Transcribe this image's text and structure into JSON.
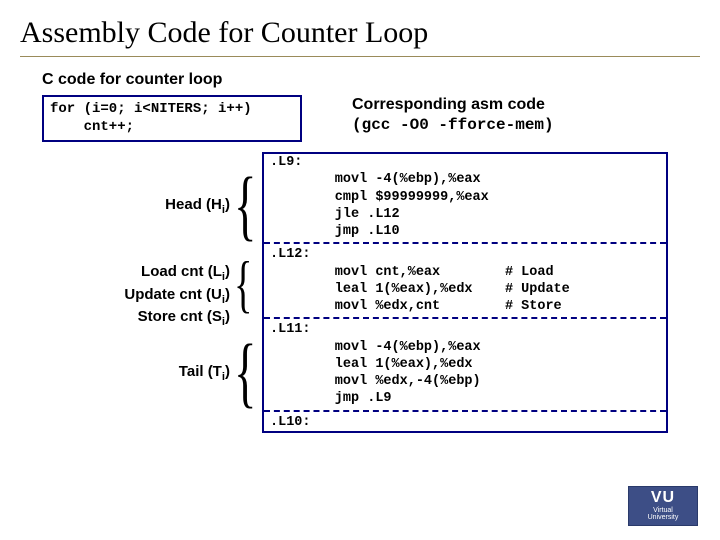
{
  "title": "Assembly Code for Counter Loop",
  "c_heading": "C code for counter loop",
  "c_code_l1": "for (i=0; i<NITERS; i++)",
  "c_code_l2": "    cnt++;",
  "asm_title": "Corresponding asm code",
  "asm_sub": "(gcc -O0 -fforce-mem)",
  "labels": {
    "head": "Head (H",
    "load": "Load cnt (L",
    "update": "Update cnt (U",
    "store": "Store cnt (S",
    "tail": "Tail (T",
    "sub": "i",
    "close": ")"
  },
  "asm": {
    "L9": ".L9:",
    "a1": "        movl -4(%ebp),%eax",
    "a2": "        cmpl $99999999,%eax",
    "a3": "        jle .L12",
    "a4": "        jmp .L10",
    "L12": ".L12:",
    "b1": "        movl cnt,%eax        # Load",
    "b2": "        leal 1(%eax),%edx    # Update",
    "b3": "        movl %edx,cnt        # Store",
    "L11": ".L11:",
    "c1": "        movl -4(%ebp),%eax",
    "c2": "        leal 1(%eax),%edx",
    "c3": "        movl %edx,-4(%ebp)",
    "c4": "        jmp .L9",
    "L10": ".L10:"
  },
  "logo": {
    "vu": "VU",
    "sm1": "Virtual",
    "sm2": "University"
  }
}
